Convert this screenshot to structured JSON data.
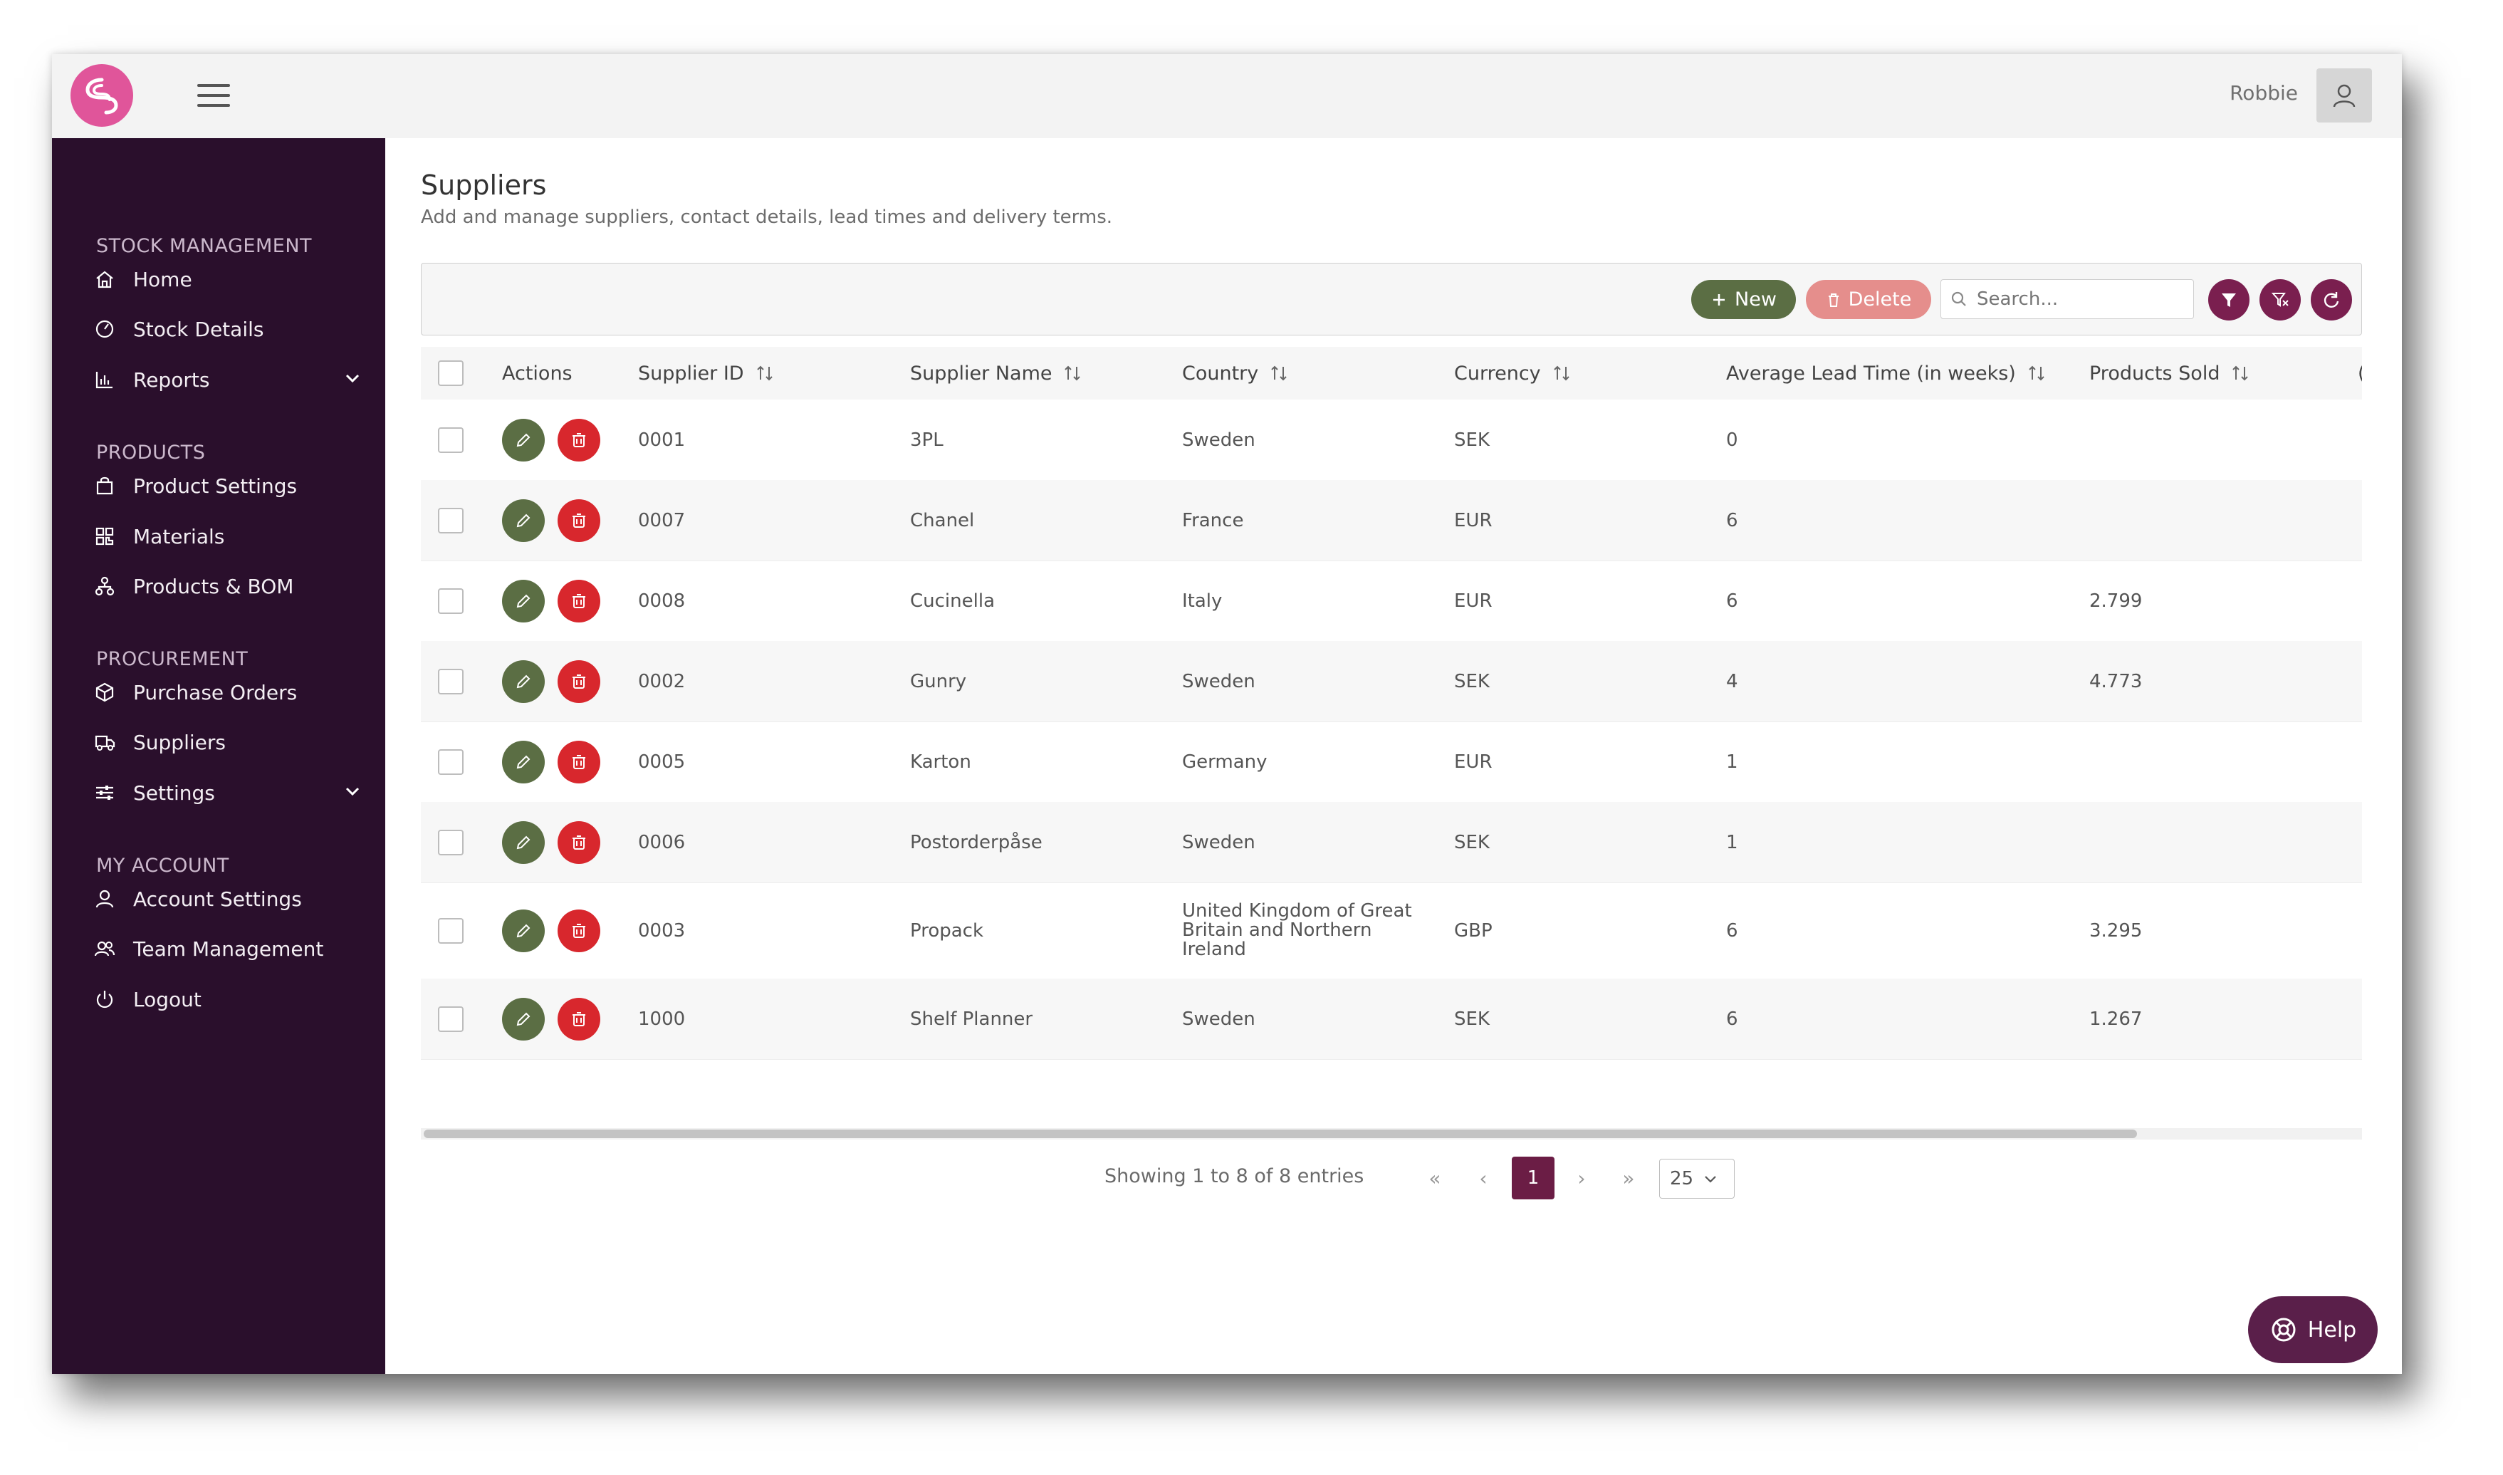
{
  "header": {
    "username": "Robbie"
  },
  "sidebar": {
    "sections": [
      {
        "title": "STOCK MANAGEMENT",
        "items": [
          "Home",
          "Stock Details",
          "Reports"
        ]
      },
      {
        "title": "PRODUCTS",
        "items": [
          "Product Settings",
          "Materials",
          "Products & BOM"
        ]
      },
      {
        "title": "PROCUREMENT",
        "items": [
          "Purchase Orders",
          "Suppliers",
          "Settings"
        ]
      },
      {
        "title": "MY ACCOUNT",
        "items": [
          "Account Settings",
          "Team Management",
          "Logout"
        ]
      }
    ]
  },
  "page": {
    "title": "Suppliers",
    "subtitle": "Add and manage suppliers, contact details, lead times and delivery terms."
  },
  "toolbar": {
    "new_label": "New",
    "delete_label": "Delete",
    "search_placeholder": "Search..."
  },
  "table": {
    "columns": [
      "Actions",
      "Supplier ID",
      "Supplier Name",
      "Country",
      "Currency",
      "Average Lead Time (in weeks)",
      "Products Sold"
    ],
    "rows": [
      {
        "id": "0001",
        "name": "3PL",
        "country": "Sweden",
        "currency": "SEK",
        "lead": "0",
        "sold": ""
      },
      {
        "id": "0007",
        "name": "Chanel",
        "country": "France",
        "currency": "EUR",
        "lead": "6",
        "sold": ""
      },
      {
        "id": "0008",
        "name": "Cucinella",
        "country": "Italy",
        "currency": "EUR",
        "lead": "6",
        "sold": "2.799"
      },
      {
        "id": "0002",
        "name": "Gunry",
        "country": "Sweden",
        "currency": "SEK",
        "lead": "4",
        "sold": "4.773"
      },
      {
        "id": "0005",
        "name": "Karton",
        "country": "Germany",
        "currency": "EUR",
        "lead": "1",
        "sold": ""
      },
      {
        "id": "0006",
        "name": "Postorderpåse",
        "country": "Sweden",
        "currency": "SEK",
        "lead": "1",
        "sold": ""
      },
      {
        "id": "0003",
        "name": "Propack",
        "country": "United Kingdom of Great Britain and Northern Ireland",
        "currency": "GBP",
        "lead": "6",
        "sold": "3.295"
      },
      {
        "id": "1000",
        "name": "Shelf Planner",
        "country": "Sweden",
        "currency": "SEK",
        "lead": "6",
        "sold": "1.267"
      }
    ]
  },
  "pagination": {
    "showing": "Showing 1 to 8 of 8 entries",
    "current_page": "1",
    "page_size": "25"
  },
  "help": {
    "label": "Help"
  }
}
